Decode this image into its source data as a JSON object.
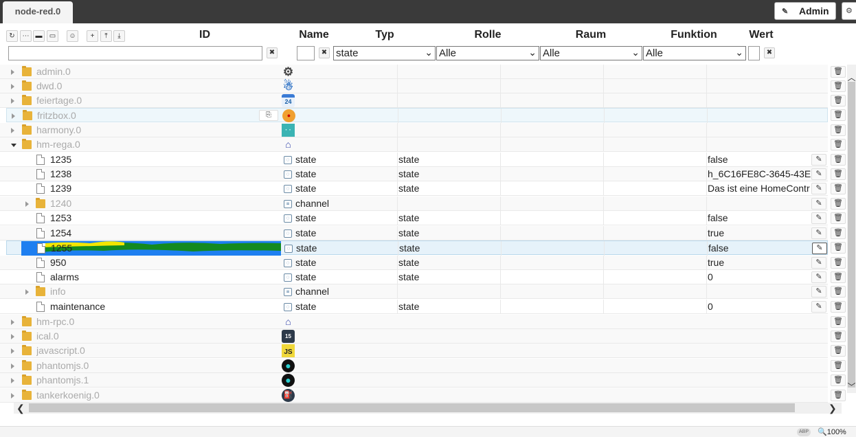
{
  "tab_title": "node-red.0",
  "admin_label": "Admin",
  "icons": {
    "edit": "pencil-icon",
    "settings": "gear-icon",
    "delete": "trash-icon",
    "paste": "clipboard-icon"
  },
  "toolbar": [
    "refresh-icon",
    "collapse-icon",
    "folder-icon",
    "folder-open-icon",
    "user-icon",
    "add-icon",
    "upload-icon",
    "download-icon"
  ],
  "columns": {
    "id": "ID",
    "name": "Name",
    "type": "Typ",
    "role": "Rolle",
    "room": "Raum",
    "function": "Funktion",
    "value": "Wert"
  },
  "filters": {
    "type": "state",
    "role": "Alle",
    "room": "Alle",
    "function": "Alle"
  },
  "rows": [
    {
      "id": "admin.0",
      "adapter": "gear"
    },
    {
      "id": "dwd.0",
      "adapter": "dwd"
    },
    {
      "id": "feiertage.0",
      "adapter": "calendar",
      "badge": "24"
    },
    {
      "id": "fritzbox.0",
      "adapter": "fritzbox"
    },
    {
      "id": "harmony.0",
      "adapter": "harmony",
      "badge": "· ·"
    },
    {
      "id": "hm-rega.0",
      "adapter": "homematic"
    },
    {
      "id": "1235",
      "name": "state",
      "role": "state",
      "value": "false"
    },
    {
      "id": "1238",
      "name": "state",
      "role": "state",
      "value": "h_6C16FE8C-3645-43E"
    },
    {
      "id": "1239",
      "name": "state",
      "role": "state",
      "value": "Das ist eine HomeContr"
    },
    {
      "id": "1240",
      "name": "channel"
    },
    {
      "id": "1253",
      "name": "state",
      "role": "state",
      "value": "false"
    },
    {
      "id": "1254",
      "name": "state",
      "role": "state",
      "value": "true"
    },
    {
      "id": "1255",
      "name": "state",
      "role": "state",
      "value": "false"
    },
    {
      "id": "950",
      "name": "state",
      "role": "state",
      "value": "true"
    },
    {
      "id": "alarms",
      "name": "state",
      "role": "state",
      "value": "0"
    },
    {
      "id": "info",
      "name": "channel"
    },
    {
      "id": "maintenance",
      "name": "state",
      "role": "state",
      "value": "0"
    },
    {
      "id": "hm-rpc.0",
      "adapter": "homematic"
    },
    {
      "id": "ical.0",
      "adapter": "ical",
      "badge": "15"
    },
    {
      "id": "javascript.0",
      "adapter": "javascript",
      "badge": "JS"
    },
    {
      "id": "phantomjs.0",
      "adapter": "phantomjs"
    },
    {
      "id": "phantomjs.1",
      "adapter": "phantomjs"
    },
    {
      "id": "tankerkoenig.0",
      "adapter": "tankerkoenig"
    }
  ],
  "status": {
    "abp": "ABP",
    "zoom": "100%"
  }
}
